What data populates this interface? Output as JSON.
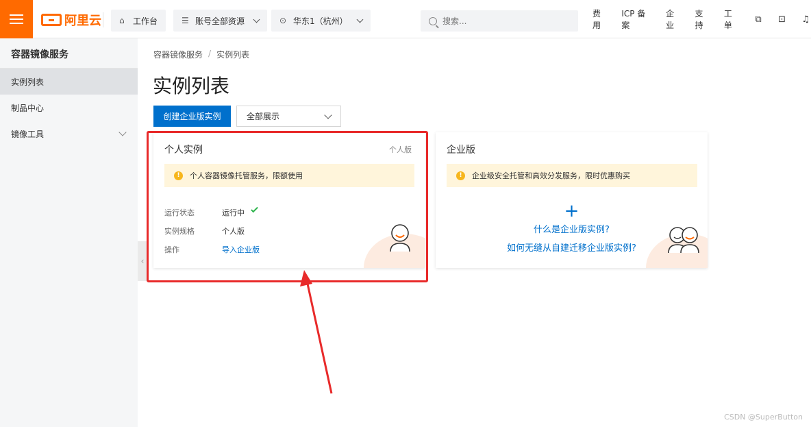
{
  "header": {
    "logo_text": "阿里云",
    "workbench_label": "工作台",
    "resources_label": "账号全部资源",
    "region_label": "华东1（杭州）",
    "search_placeholder": "搜索...",
    "links": [
      "费用",
      "ICP 备案",
      "企业",
      "支持",
      "工单"
    ]
  },
  "sidebar": {
    "title": "容器镜像服务",
    "items": [
      {
        "label": "实例列表"
      },
      {
        "label": "制品中心"
      },
      {
        "label": "镜像工具"
      }
    ]
  },
  "breadcrumb": {
    "root": "容器镜像服务",
    "separator": "/",
    "current": "实例列表"
  },
  "page": {
    "title": "实例列表",
    "create_button": "创建企业版实例",
    "filter_value": "全部展示"
  },
  "personal_card": {
    "title": "个人实例",
    "tag": "个人版",
    "notice": "个人容器镜像托管服务，限额使用",
    "rows": [
      {
        "key": "运行状态",
        "value": "运行中"
      },
      {
        "key": "实例规格",
        "value": "个人版"
      },
      {
        "key": "操作",
        "value": "导入企业版"
      }
    ]
  },
  "enterprise_card": {
    "title": "企业版",
    "notice": "企业级安全托管和高效分发服务，限时优惠购买",
    "plus": "+",
    "link1": "什么是企业版实例?",
    "link2": "如何无缝从自建迁移企业版实例?"
  },
  "watermark": "CSDN @SuperButton",
  "colors": {
    "brand_orange": "#ff6a00",
    "primary_blue": "#0070cc",
    "annotation_red": "#e82a2a",
    "notice_bg": "#fff5db"
  }
}
